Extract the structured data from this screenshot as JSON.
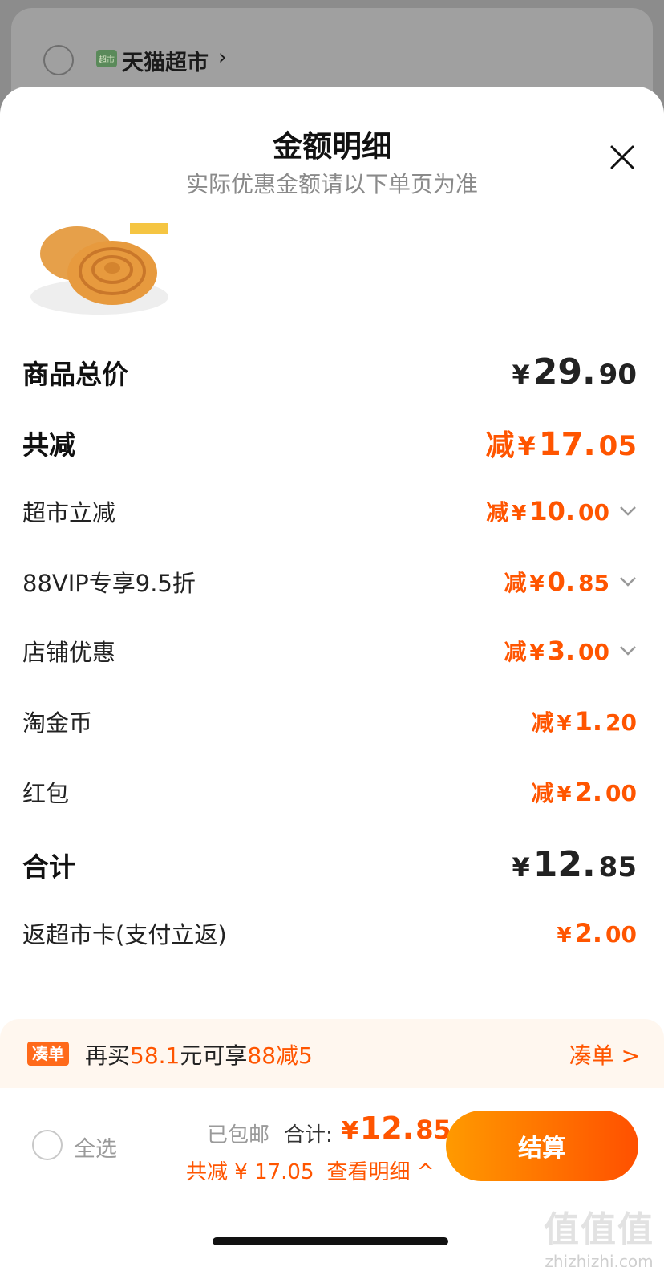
{
  "background": {
    "store_name": "天猫超市",
    "store_logo_text": "超市"
  },
  "sheet": {
    "title": "金额明细",
    "subtitle": "实际优惠金额请以下单页为准"
  },
  "rows": {
    "goods_total": {
      "label": "商品总价",
      "yen": "¥",
      "int": "29.",
      "dec": "90"
    },
    "total_discount": {
      "label": "共减",
      "prefix": "减",
      "yen": "¥",
      "int": "17.",
      "dec": "05"
    },
    "market_discount": {
      "label": "超市立减",
      "prefix": "减",
      "yen": "¥",
      "int": "10.",
      "dec": "00"
    },
    "vip_discount": {
      "label": "88VIP专享9.5折",
      "prefix": "减",
      "yen": "¥",
      "int": "0.",
      "dec": "85"
    },
    "shop_discount": {
      "label": "店铺优惠",
      "prefix": "减",
      "yen": "¥",
      "int": "3.",
      "dec": "00"
    },
    "taojinbi": {
      "label": "淘金币",
      "prefix": "减",
      "yen": "¥",
      "int": "1.",
      "dec": "20"
    },
    "red_packet": {
      "label": "红包",
      "prefix": "减",
      "yen": "¥",
      "int": "2.",
      "dec": "00"
    },
    "sum": {
      "label": "合计",
      "yen": "¥",
      "int": "12.",
      "dec": "85"
    },
    "rebate": {
      "label": "返超市卡(支付立返)",
      "yen": "¥",
      "int": "2.",
      "dec": "00"
    }
  },
  "promo": {
    "tag": "凑单",
    "text_1": "再买",
    "amount": "58.1",
    "text_2": "元可享",
    "offer": "88减5",
    "link": "凑单 >"
  },
  "bottom": {
    "select_all": "全选",
    "shipping": "已包邮",
    "total_label": "合计:",
    "total_yen": "¥",
    "total_int": "12.",
    "total_dec": "85",
    "save_text": "共减 ¥ 17.05",
    "detail_link": "查看明细 ^",
    "checkout": "结算"
  },
  "watermark": {
    "logo": "值值值",
    "url": "zhizhizhi.com"
  },
  "colors": {
    "accent": "#ff5500",
    "checkout_gradient_start": "#ff9a00",
    "checkout_gradient_end": "#ff5000"
  }
}
